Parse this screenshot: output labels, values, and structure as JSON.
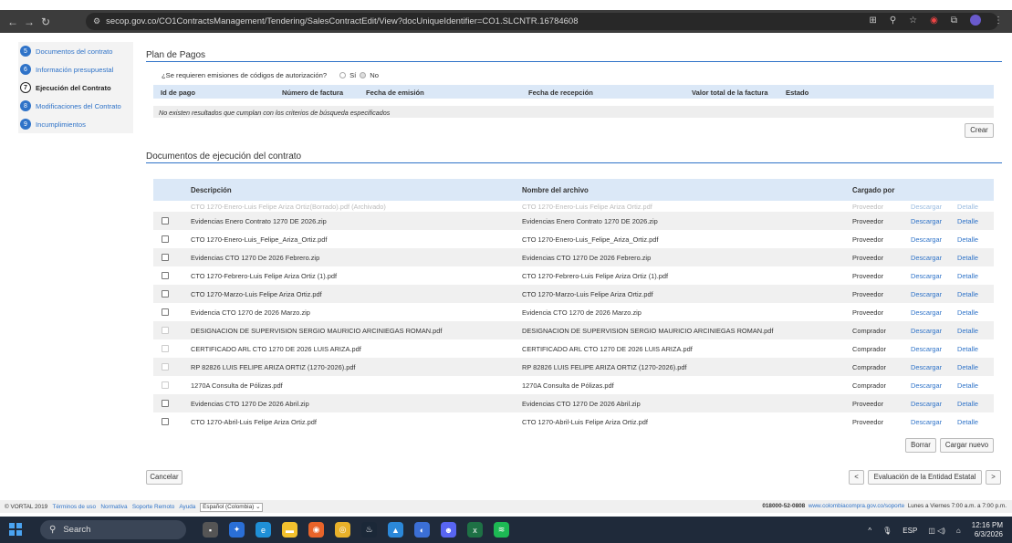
{
  "browser": {
    "url": "secop.gov.co/CO1ContractsManagement/Tendering/SalesContractEdit/View?docUniqueIdentifier=CO1.SLCNTR.16784608"
  },
  "steps": [
    {
      "num": "5",
      "label": "Documentos del contrato",
      "active": false
    },
    {
      "num": "6",
      "label": "Información presupuestal",
      "active": false
    },
    {
      "num": "7",
      "label": "Ejecución del Contrato",
      "active": true
    },
    {
      "num": "8",
      "label": "Modificaciones del Contrato",
      "active": false
    },
    {
      "num": "9",
      "label": "Incumplimientos",
      "active": false
    }
  ],
  "plan": {
    "title": "Plan de Pagos",
    "auth_question": "¿Se requieren emisiones de códigos de autorización?",
    "opt_yes": "Sí",
    "opt_no": "No",
    "columns": [
      "Id de pago",
      "Número de factura",
      "Fecha de emisión",
      "Fecha de recepción",
      "Valor total de la factura",
      "Estado"
    ],
    "empty_text": "No existen resultados que cumplan con los criterios de búsqueda especificados",
    "create_label": "Crear"
  },
  "docs": {
    "title": "Documentos de ejecución del contrato",
    "col_desc": "Descripción",
    "col_file": "Nombre del archivo",
    "col_by": "Cargado por",
    "ghost": {
      "desc": "CTO 1270-Enero-Luis Felipe Ariza Ortiz(Borrado).pdf (Archivado)",
      "file": "CTO 1270-Enero-Luis Felipe Ariza Ortiz.pdf",
      "by": "Proveedor",
      "download": "Descargar",
      "detail": "Detalle"
    },
    "rows": [
      {
        "desc": "Evidencias Enero Contrato 1270 DE 2026.zip",
        "file": "Evidencias Enero Contrato 1270 DE 2026.zip",
        "by": "Proveedor",
        "enabled": true
      },
      {
        "desc": "CTO 1270-Enero-Luis_Felipe_Ariza_Ortiz.pdf",
        "file": "CTO 1270-Enero-Luis_Felipe_Ariza_Ortiz.pdf",
        "by": "Proveedor",
        "enabled": true
      },
      {
        "desc": "Evidencias CTO 1270 De 2026 Febrero.zip",
        "file": "Evidencias CTO 1270 De 2026 Febrero.zip",
        "by": "Proveedor",
        "enabled": true
      },
      {
        "desc": "CTO 1270-Febrero-Luis Felipe Ariza Ortiz (1).pdf",
        "file": "CTO 1270-Febrero-Luis Felipe Ariza Ortiz (1).pdf",
        "by": "Proveedor",
        "enabled": true
      },
      {
        "desc": "CTO 1270-Marzo-Luis Felipe Ariza Ortiz.pdf",
        "file": "CTO 1270-Marzo-Luis Felipe Ariza Ortiz.pdf",
        "by": "Proveedor",
        "enabled": true
      },
      {
        "desc": "Evidencia CTO 1270 de 2026 Marzo.zip",
        "file": "Evidencia CTO 1270 de 2026 Marzo.zip",
        "by": "Proveedor",
        "enabled": true
      },
      {
        "desc": "DESIGNACION DE SUPERVISION SERGIO MAURICIO ARCINIEGAS ROMAN.pdf",
        "file": "DESIGNACION DE SUPERVISION SERGIO MAURICIO ARCINIEGAS ROMAN.pdf",
        "by": "Comprador",
        "enabled": false
      },
      {
        "desc": "CERTIFICADO ARL CTO 1270 DE 2026 LUIS ARIZA.pdf",
        "file": "CERTIFICADO ARL CTO 1270 DE 2026 LUIS ARIZA.pdf",
        "by": "Comprador",
        "enabled": false
      },
      {
        "desc": "RP 82826 LUIS FELIPE ARIZA ORTIZ (1270-2026).pdf",
        "file": "RP 82826 LUIS FELIPE ARIZA ORTIZ (1270-2026).pdf",
        "by": "Comprador",
        "enabled": false
      },
      {
        "desc": "1270A Consulta de Pólizas.pdf",
        "file": "1270A Consulta de Pólizas.pdf",
        "by": "Comprador",
        "enabled": false
      },
      {
        "desc": "Evidencias CTO 1270 De 2026 Abril.zip",
        "file": "Evidencias CTO 1270 De 2026 Abril.zip",
        "by": "Proveedor",
        "enabled": true
      },
      {
        "desc": "CTO 1270-Abril-Luis Felipe Ariza Ortiz.pdf",
        "file": "CTO 1270-Abril-Luis Felipe Ariza Ortiz.pdf",
        "by": "Proveedor",
        "enabled": true
      }
    ],
    "download_label": "Descargar",
    "detail_label": "Detalle",
    "delete_label": "Borrar",
    "upload_label": "Cargar nuevo"
  },
  "actions": {
    "cancel": "Cancelar",
    "prev": "<",
    "next_step": "Evaluación de la Entidad Estatal",
    "next": ">"
  },
  "footer": {
    "copyright": "© VORTAL 2019",
    "terms": "Términos de uso",
    "normativa": "Normativa",
    "soporte": "Soporte Remoto",
    "ayuda": "Ayuda",
    "language": "Español (Colombia)",
    "phone": "018000-52-0808",
    "support_url": "www.colombiacompra.gov.co/soporte",
    "hours": "Lunes a Viernes 7:00 a.m. a 7:00 p.m."
  },
  "taskbar": {
    "search": "Search",
    "lang": "ESP",
    "time": "12:16 PM",
    "date": "6/3/2026"
  }
}
